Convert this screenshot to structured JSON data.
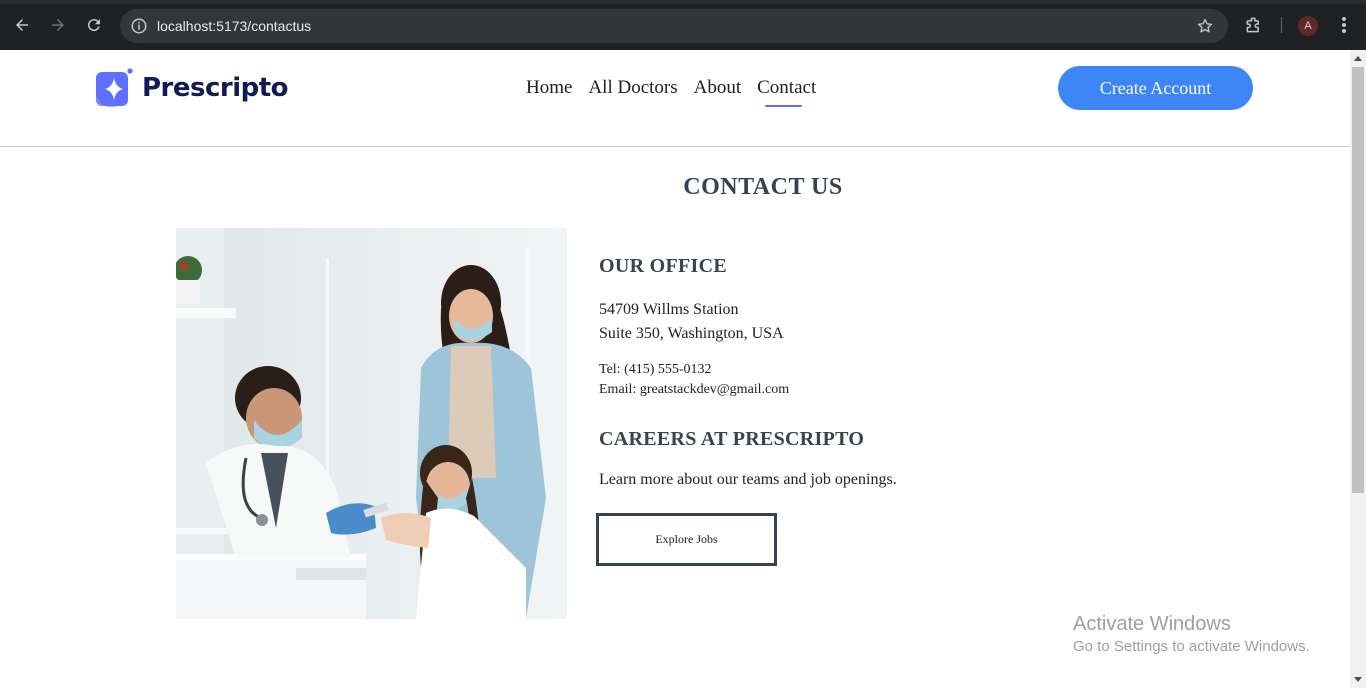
{
  "browser": {
    "url_host": "localhost",
    "url_rest": ":5173/contactus",
    "profile_initial": "A",
    "icons": [
      "back-arrow-icon",
      "forward-arrow-icon",
      "reload-icon",
      "site-info-icon",
      "star-icon",
      "extensions-icon",
      "kebab-menu-icon"
    ]
  },
  "navbar": {
    "brand": "Prescripto",
    "links": [
      {
        "label": "Home",
        "active": false
      },
      {
        "label": "All Doctors",
        "active": false
      },
      {
        "label": "About",
        "active": false
      },
      {
        "label": "Contact",
        "active": true
      }
    ],
    "cta": "Create Account"
  },
  "content": {
    "title": "CONTACT US",
    "office_heading": "OUR OFFICE",
    "address_line1": "54709 Willms Station",
    "address_line2": "Suite 350, Washington, USA",
    "phone": "Tel: (415) 555-0132",
    "email": "Email: greatstackdev@gmail.com",
    "careers_heading": "CAREERS AT PRESCRIPTO",
    "careers_text": "Learn more about our teams and job openings.",
    "jobs_button": "Explore Jobs"
  },
  "watermark": {
    "line1": "Activate Windows",
    "line2": "Go to Settings to activate Windows."
  },
  "colors": {
    "primary": "#3e85f7",
    "brand_text": "#101a57",
    "heading": "#374151",
    "chrome_bg": "#202124"
  }
}
